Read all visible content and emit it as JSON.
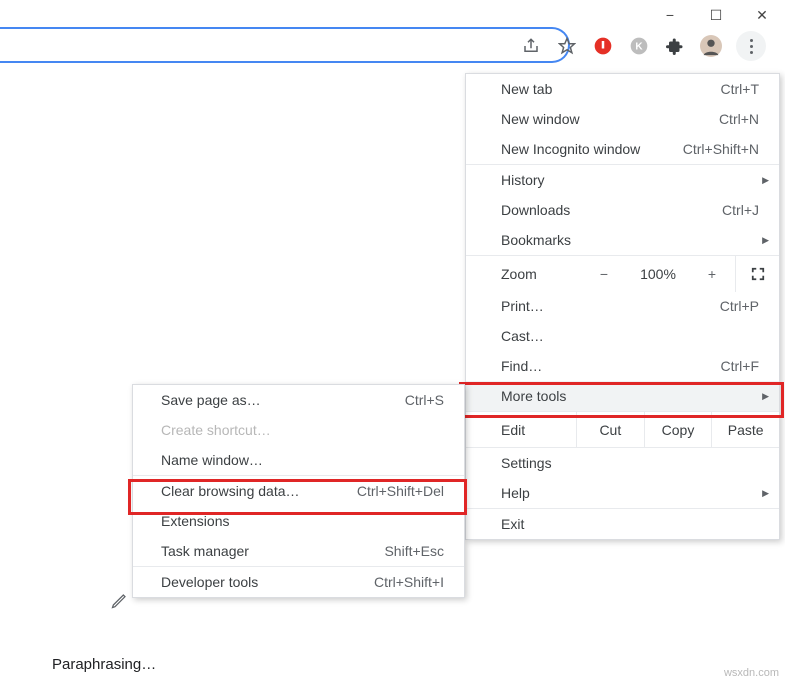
{
  "window": {
    "min": "−",
    "max": "☐",
    "close": "✕"
  },
  "toolbar": {
    "share": "share-icon",
    "star": "star-icon",
    "ext1": "shield-icon",
    "ext2": "k-icon",
    "ext3": "puzzle-icon",
    "avatar": "avatar"
  },
  "menu": {
    "new_tab": "New tab",
    "new_tab_sc": "Ctrl+T",
    "new_window": "New window",
    "new_window_sc": "Ctrl+N",
    "incognito": "New Incognito window",
    "incognito_sc": "Ctrl+Shift+N",
    "history": "History",
    "downloads": "Downloads",
    "downloads_sc": "Ctrl+J",
    "bookmarks": "Bookmarks",
    "zoom_label": "Zoom",
    "zoom_minus": "−",
    "zoom_val": "100%",
    "zoom_plus": "+",
    "print": "Print…",
    "print_sc": "Ctrl+P",
    "cast": "Cast…",
    "find": "Find…",
    "find_sc": "Ctrl+F",
    "more_tools": "More tools",
    "edit": "Edit",
    "cut": "Cut",
    "copy": "Copy",
    "paste": "Paste",
    "settings": "Settings",
    "help": "Help",
    "exit": "Exit"
  },
  "submenu": {
    "save_as": "Save page as…",
    "save_as_sc": "Ctrl+S",
    "create_shortcut": "Create shortcut…",
    "name_window": "Name window…",
    "clear_data": "Clear browsing data…",
    "clear_data_sc": "Ctrl+Shift+Del",
    "extensions": "Extensions",
    "task_manager": "Task manager",
    "task_manager_sc": "Shift+Esc",
    "dev_tools": "Developer tools",
    "dev_tools_sc": "Ctrl+Shift+I"
  },
  "bottom": {
    "paraphrasing": "Paraphrasing…"
  },
  "watermark": "wsxdn.com"
}
